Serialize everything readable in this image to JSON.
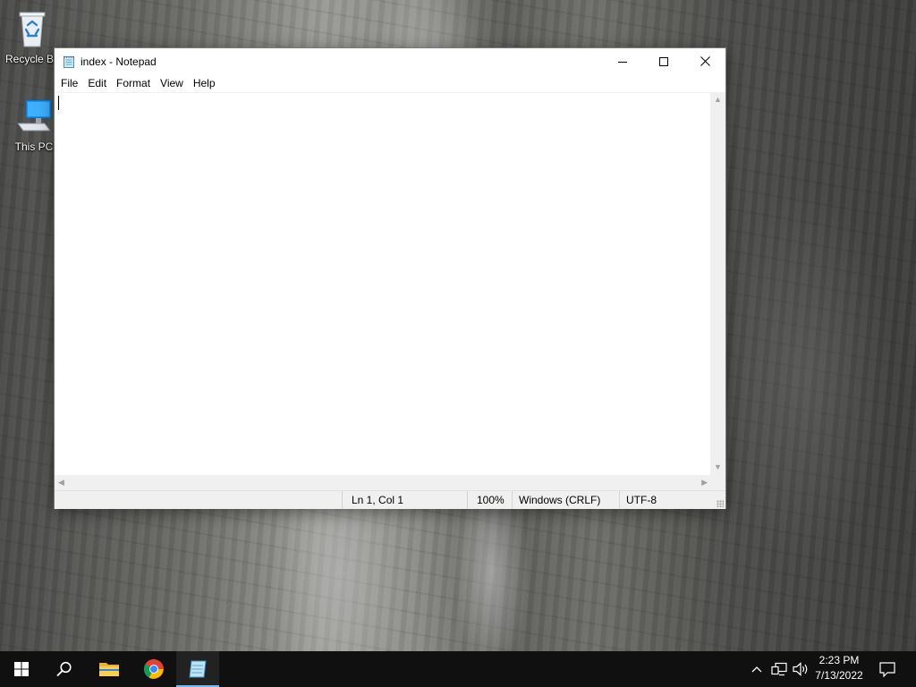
{
  "desktop": {
    "icons": [
      {
        "label": "Recycle Bin",
        "icon": "recycle-bin-icon"
      },
      {
        "label": "This PC",
        "icon": "computer-icon"
      }
    ]
  },
  "notepad": {
    "title": "index - Notepad",
    "menu": [
      "File",
      "Edit",
      "Format",
      "View",
      "Help"
    ],
    "content": "",
    "status": {
      "position": "Ln 1, Col 1",
      "zoom": "100%",
      "line_ending": "Windows (CRLF)",
      "encoding": "UTF-8"
    }
  },
  "taskbar": {
    "apps": [
      {
        "name": "start",
        "icon": "windows-start-icon"
      },
      {
        "name": "search",
        "icon": "search-icon"
      },
      {
        "name": "file-explorer",
        "icon": "folder-icon"
      },
      {
        "name": "chrome",
        "icon": "chrome-icon"
      },
      {
        "name": "notepad",
        "icon": "notepad-icon",
        "active": true
      }
    ],
    "clock": {
      "time": "2:23 PM",
      "date": "7/13/2022"
    }
  },
  "colors": {
    "taskbar": "#101010",
    "active_indicator": "#76b9ed",
    "status_bar": "#f0f0f0"
  }
}
